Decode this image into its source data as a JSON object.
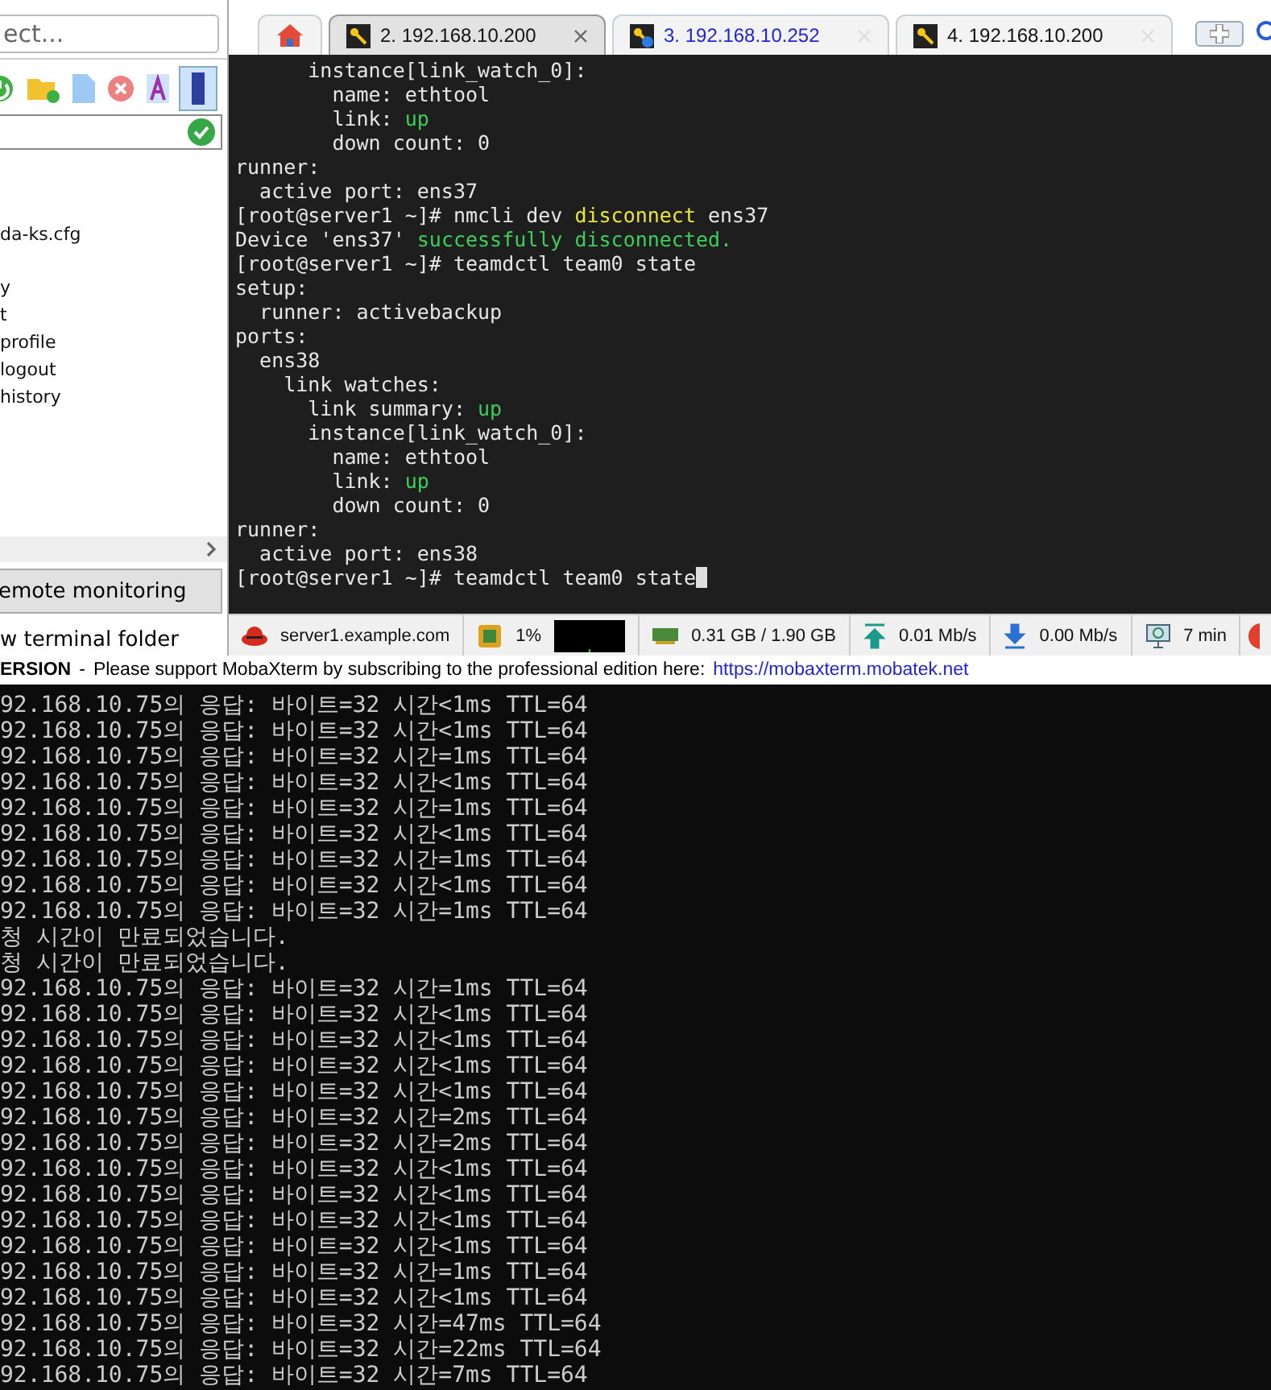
{
  "sidebar": {
    "search": {
      "value": "ect..."
    },
    "files": [
      {
        "name": "da-ks.cfg"
      },
      {
        "name": "y"
      },
      {
        "name": "t"
      },
      {
        "name": "profile"
      },
      {
        "name": "logout"
      },
      {
        "name": "history"
      }
    ],
    "monitoring_button": "emote monitoring",
    "folder_option": "w terminal folder"
  },
  "tabs": [
    {
      "kind": "home"
    },
    {
      "kind": "session",
      "label": "2. 192.168.10.200",
      "selected": true,
      "highlighted": false
    },
    {
      "kind": "session",
      "label": "3. 192.168.10.252",
      "selected": false,
      "highlighted": true
    },
    {
      "kind": "session",
      "label": "4. 192.168.10.200",
      "selected": false,
      "highlighted": false
    },
    {
      "kind": "new"
    }
  ],
  "terminal": {
    "cursor": true,
    "lines": [
      [
        {
          "text": "      instance[link_watch_0]:"
        }
      ],
      [
        {
          "text": "        name: ethtool"
        }
      ],
      [
        {
          "text": "        link: "
        },
        {
          "text": "up",
          "kind": "green"
        }
      ],
      [
        {
          "text": "        down count: 0"
        }
      ],
      [
        {
          "text": "runner:"
        }
      ],
      [
        {
          "text": "  active port: ens37"
        }
      ],
      [
        {
          "text": "[root@server1 ~]# nmcli dev "
        },
        {
          "text": "disconnect",
          "kind": "yellow"
        },
        {
          "text": " ens37"
        }
      ],
      [
        {
          "text": "Device 'ens37' "
        },
        {
          "text": "successfully disconnected.",
          "kind": "green"
        }
      ],
      [
        {
          "text": "[root@server1 ~]# teamdctl team0 state"
        }
      ],
      [
        {
          "text": "setup:"
        }
      ],
      [
        {
          "text": "  runner: activebackup"
        }
      ],
      [
        {
          "text": "ports:"
        }
      ],
      [
        {
          "text": "  ens38"
        }
      ],
      [
        {
          "text": "    link watches:"
        }
      ],
      [
        {
          "text": "      link summary: "
        },
        {
          "text": "up",
          "kind": "green"
        }
      ],
      [
        {
          "text": "      instance[link_watch_0]:"
        }
      ],
      [
        {
          "text": "        name: ethtool"
        }
      ],
      [
        {
          "text": "        link: "
        },
        {
          "text": "up",
          "kind": "green"
        }
      ],
      [
        {
          "text": "        down count: 0"
        }
      ],
      [
        {
          "text": "runner:"
        }
      ],
      [
        {
          "text": "  active port: ens38"
        }
      ],
      [
        {
          "text": "[root@server1 ~]# teamdctl team0 state"
        }
      ]
    ]
  },
  "status_bar": {
    "host": "server1.example.com",
    "cpu": "1%",
    "memory": "0.31 GB / 1.90 GB",
    "upload": "0.01 Mb/s",
    "download": "0.00 Mb/s",
    "uptime": "7 min"
  },
  "banner": {
    "edition": "ERSION",
    "separator": "-",
    "message": "Please support MobaXterm by subscribing to the professional edition here:",
    "link": "https://mobaxterm.mobatek.net"
  },
  "console": {
    "lines": [
      "92.168.10.75의 응답: 바이트=32 시간<1ms TTL=64",
      "92.168.10.75의 응답: 바이트=32 시간<1ms TTL=64",
      "92.168.10.75의 응답: 바이트=32 시간=1ms TTL=64",
      "92.168.10.75의 응답: 바이트=32 시간<1ms TTL=64",
      "92.168.10.75의 응답: 바이트=32 시간=1ms TTL=64",
      "92.168.10.75의 응답: 바이트=32 시간<1ms TTL=64",
      "92.168.10.75의 응답: 바이트=32 시간=1ms TTL=64",
      "92.168.10.75의 응답: 바이트=32 시간<1ms TTL=64",
      "92.168.10.75의 응답: 바이트=32 시간=1ms TTL=64",
      "청 시간이 만료되었습니다.",
      "청 시간이 만료되었습니다.",
      "92.168.10.75의 응답: 바이트=32 시간=1ms TTL=64",
      "92.168.10.75의 응답: 바이트=32 시간<1ms TTL=64",
      "92.168.10.75의 응답: 바이트=32 시간<1ms TTL=64",
      "92.168.10.75의 응답: 바이트=32 시간<1ms TTL=64",
      "92.168.10.75의 응답: 바이트=32 시간<1ms TTL=64",
      "92.168.10.75의 응답: 바이트=32 시간=2ms TTL=64",
      "92.168.10.75의 응답: 바이트=32 시간=2ms TTL=64",
      "92.168.10.75의 응답: 바이트=32 시간<1ms TTL=64",
      "92.168.10.75의 응답: 바이트=32 시간<1ms TTL=64",
      "92.168.10.75의 응답: 바이트=32 시간<1ms TTL=64",
      "92.168.10.75의 응답: 바이트=32 시간<1ms TTL=64",
      "92.168.10.75의 응답: 바이트=32 시간=1ms TTL=64",
      "92.168.10.75의 응답: 바이트=32 시간<1ms TTL=64",
      "92.168.10.75의 응답: 바이트=32 시간=47ms TTL=64",
      "92.168.10.75의 응답: 바이트=32 시간=22ms TTL=64",
      "92.168.10.75의 응답: 바이트=32 시간=7ms TTL=64"
    ]
  }
}
